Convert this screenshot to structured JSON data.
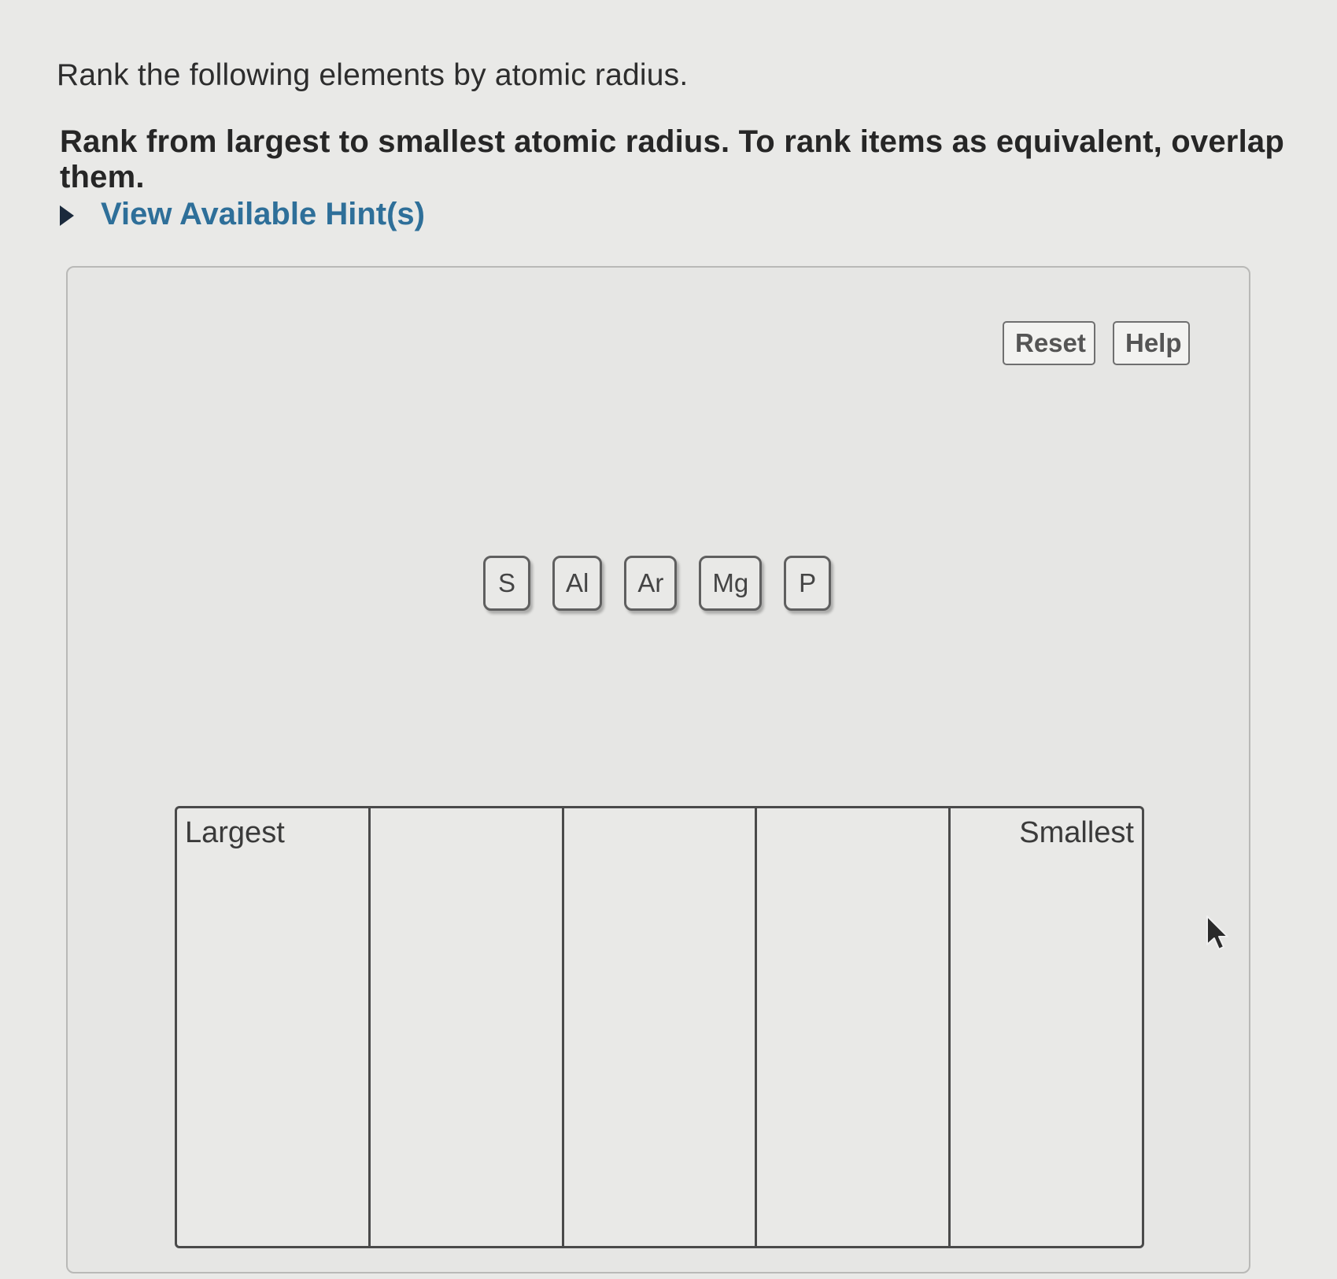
{
  "question": {
    "prompt": "Rank the following elements by atomic radius.",
    "instructions": "Rank from largest to smallest atomic radius. To rank items as equivalent, overlap them.",
    "hint_link": "View Available Hint(s)"
  },
  "toolbar": {
    "reset_label": "Reset",
    "help_label": "Help"
  },
  "tiles": [
    "S",
    "Al",
    "Ar",
    "Mg",
    "P"
  ],
  "ranking": {
    "largest_label": "Largest",
    "smallest_label": "Smallest",
    "bin_count": 5
  }
}
